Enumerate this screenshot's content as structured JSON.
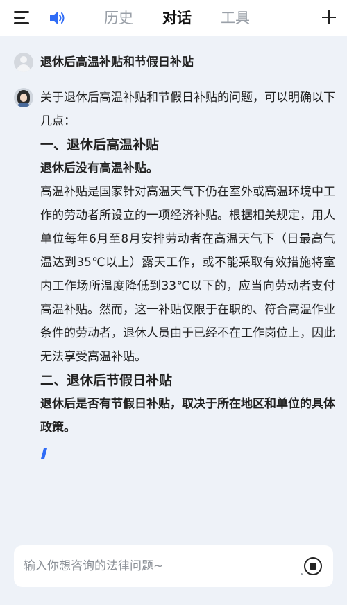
{
  "header": {
    "tabs": [
      {
        "label": "历史",
        "active": false
      },
      {
        "label": "对话",
        "active": true
      },
      {
        "label": "工具",
        "active": false
      }
    ]
  },
  "conversation": {
    "user_question": "退休后高温补贴和节假日补贴",
    "answer": {
      "intro": "关于退休后高温补贴和节假日补贴的问题，可以明确以下几点：",
      "section1_heading": "一、退休后高温补贴",
      "section1_bold": "退休后没有高温补贴。",
      "section1_body": "高温补贴是国家针对高温天气下仍在室外或高温环境中工作的劳动者所设立的一项经济补贴。根据相关规定，用人单位每年6月至8月安排劳动者在高温天气下（日最高气温达到35℃以上）露天工作，或不能采取有效措施将室内工作场所温度降低到33℃以下的，应当向劳动者支付高温补贴。然而，这一补贴仅限于在职的、符合高温作业条件的劳动者，退休人员由于已经不在工作岗位上，因此无法享受高温补贴。",
      "section2_heading": "二、退休后节假日补贴",
      "section2_bold": "退休后是否有节假日补贴，取决于所在地区和单位的具体政策。"
    }
  },
  "input": {
    "placeholder": "输入你想咨询的法律问题~"
  },
  "colors": {
    "accent": "#2f6cf6",
    "background": "#eef2f8"
  },
  "icons": [
    "menu-icon",
    "speaker-icon",
    "plus-icon",
    "stop-icon"
  ]
}
